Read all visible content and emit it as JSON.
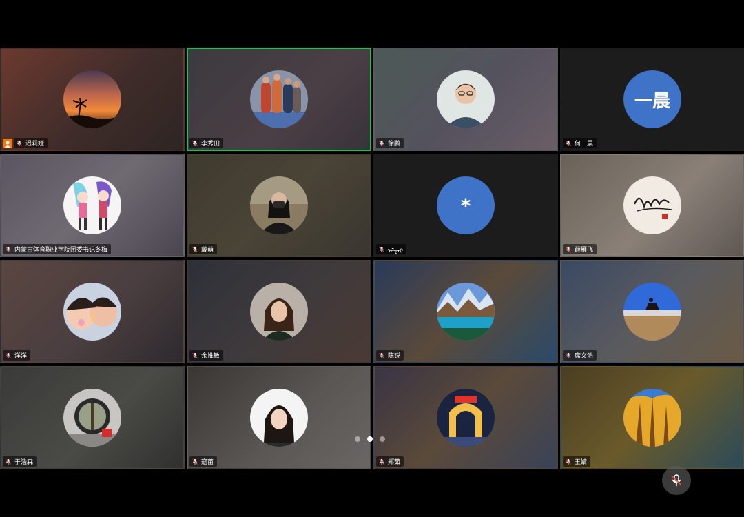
{
  "participants": [
    {
      "name": "迟莉娅",
      "avatar_type": "image",
      "avatar_desc": "sunset-palm",
      "is_host": true
    },
    {
      "name": "李秀田",
      "avatar_type": "image",
      "avatar_desc": "marathon-runners",
      "active_speaker": true
    },
    {
      "name": "徐鹏",
      "avatar_type": "image",
      "avatar_desc": "man-glasses"
    },
    {
      "name": "何一晨",
      "avatar_type": "text",
      "avatar_text": "一晨"
    },
    {
      "name": "内蒙古体育职业学院团委书记冬梅",
      "avatar_type": "image",
      "avatar_desc": "anime-characters"
    },
    {
      "name": "戴萌",
      "avatar_type": "image",
      "avatar_desc": "woman-camera"
    },
    {
      "name": "ᠠᠯᠳᠠᠷ",
      "avatar_type": "text",
      "avatar_text": "*"
    },
    {
      "name": "薛雁飞",
      "avatar_type": "image",
      "avatar_desc": "calligraphy"
    },
    {
      "name": "洋洋",
      "avatar_type": "image",
      "avatar_desc": "two-girls"
    },
    {
      "name": "余推敏",
      "avatar_type": "image",
      "avatar_desc": "woman-portrait"
    },
    {
      "name": "陈锐",
      "avatar_type": "image",
      "avatar_desc": "mountain-lake"
    },
    {
      "name": "席文浩",
      "avatar_type": "image",
      "avatar_desc": "horse-rider-plain"
    },
    {
      "name": "于浩森",
      "avatar_type": "image",
      "avatar_desc": "round-doorway"
    },
    {
      "name": "寇苗",
      "avatar_type": "image",
      "avatar_desc": "woman-smiling"
    },
    {
      "name": "郑茹",
      "avatar_type": "image",
      "avatar_desc": "lit-gate-night"
    },
    {
      "name": "王婧",
      "avatar_type": "image",
      "avatar_desc": "golden-trees"
    }
  ],
  "icons": {
    "name_tag": "mic-muted-icon",
    "host": "host-icon",
    "bottom_control": "mic-muted-icon"
  },
  "pager": {
    "pages": 3,
    "current": 2
  },
  "colors": {
    "active_border": "#1fbf5a",
    "avatar_bg": "#3f73c8",
    "host_badge": "#f07a1a"
  }
}
